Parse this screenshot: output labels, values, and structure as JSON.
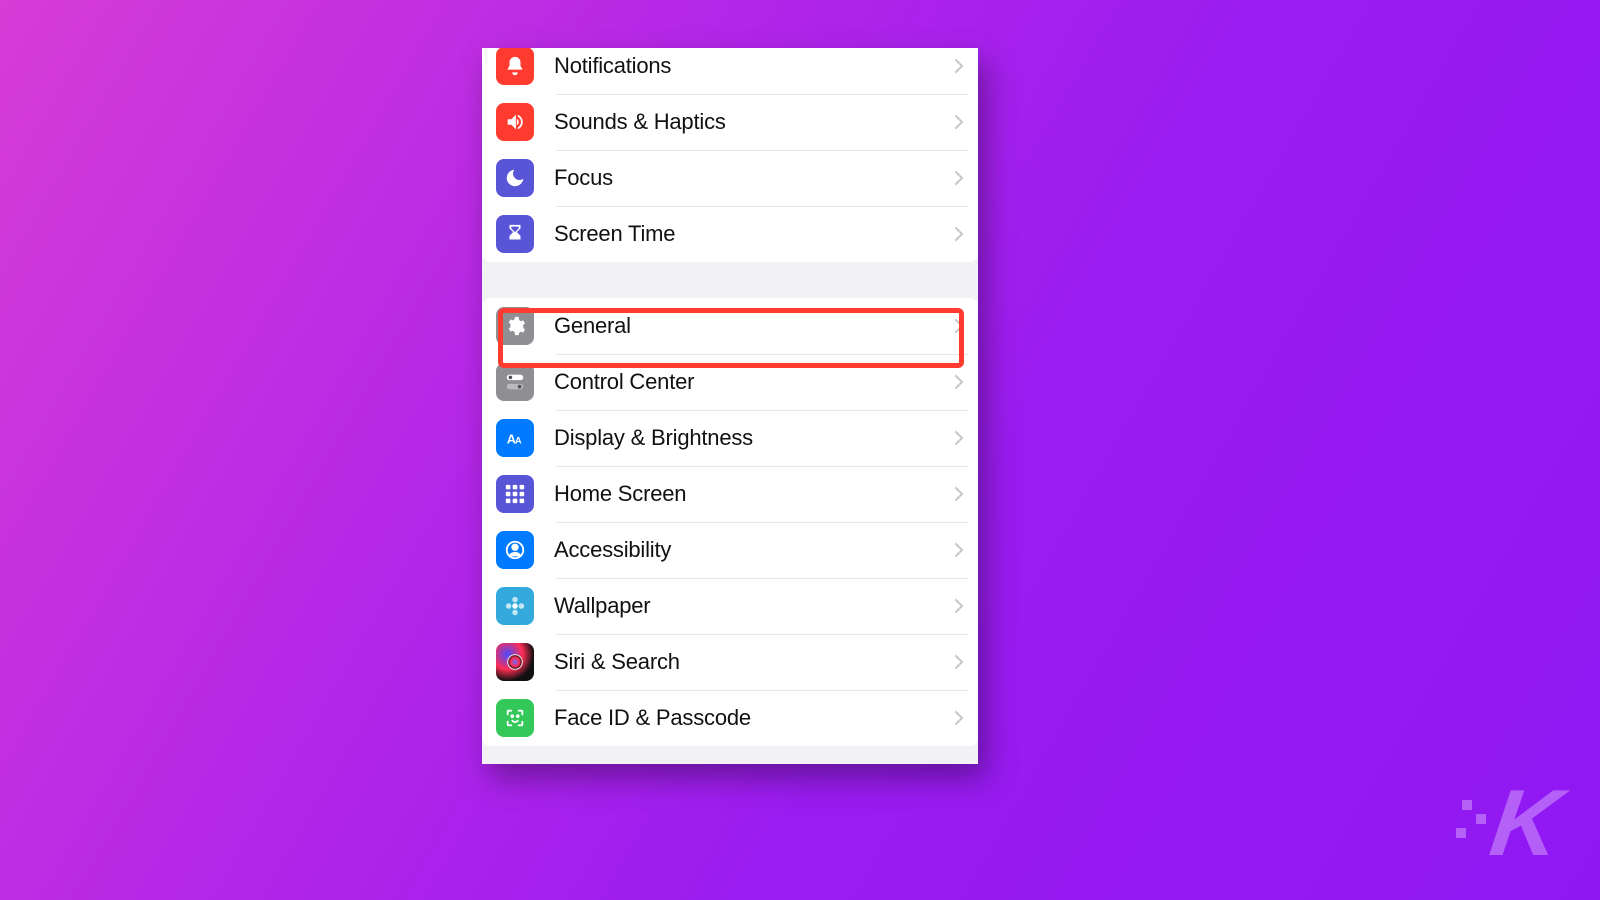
{
  "groups": [
    {
      "items": [
        {
          "id": "notifications",
          "label": "Notifications",
          "icon": "bell-icon",
          "color": "bg-red"
        },
        {
          "id": "sounds",
          "label": "Sounds & Haptics",
          "icon": "speaker-icon",
          "color": "bg-red"
        },
        {
          "id": "focus",
          "label": "Focus",
          "icon": "moon-icon",
          "color": "bg-indigo"
        },
        {
          "id": "screentime",
          "label": "Screen Time",
          "icon": "hourglass-icon",
          "color": "bg-indigo"
        }
      ]
    },
    {
      "items": [
        {
          "id": "general",
          "label": "General",
          "icon": "gear-icon",
          "color": "bg-gray",
          "highlighted": true
        },
        {
          "id": "controlcenter",
          "label": "Control Center",
          "icon": "switches-icon",
          "color": "bg-gray"
        },
        {
          "id": "display",
          "label": "Display & Brightness",
          "icon": "aa-icon",
          "color": "bg-blue"
        },
        {
          "id": "homescreen",
          "label": "Home Screen",
          "icon": "grid-icon",
          "color": "bg-indigo"
        },
        {
          "id": "accessibility",
          "label": "Accessibility",
          "icon": "person-icon",
          "color": "bg-blue"
        },
        {
          "id": "wallpaper",
          "label": "Wallpaper",
          "icon": "flower-icon",
          "color": "bg-teal"
        },
        {
          "id": "siri",
          "label": "Siri & Search",
          "icon": "siri-icon",
          "color": "bg-black"
        },
        {
          "id": "faceid",
          "label": "Face ID & Passcode",
          "icon": "faceid-icon",
          "color": "bg-green"
        }
      ]
    }
  ],
  "watermark": "K"
}
